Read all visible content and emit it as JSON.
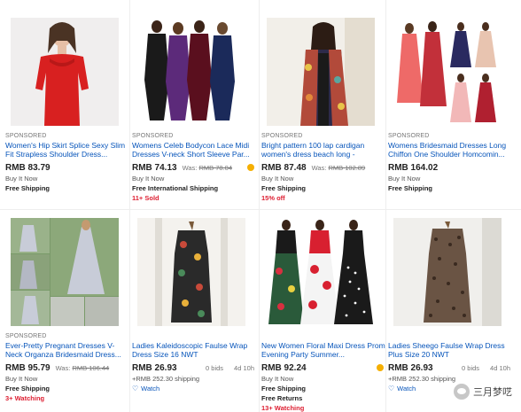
{
  "watermark_text": "三月梦呓",
  "colors": {
    "link": "#0654ba",
    "red": "#dd1e31",
    "badge": "#f5af02"
  },
  "row1": [
    {
      "sponsored": "SPONSORED",
      "title": "Women's Hip Skirt Splice Sexy Slim Fit Strapless Shoulder Dress...",
      "price": "RMB 83.79",
      "was": "",
      "line1": "Buy It Now",
      "line2": "Free Shipping",
      "line3": ""
    },
    {
      "sponsored": "SPONSORED",
      "title": "Womens Celeb Bodycon Lace Midi Dresses V-neck Short Sleeve Par...",
      "price": "RMB 74.13",
      "was_label": "Was:",
      "was": "RMB 78.04",
      "line1": "Buy It Now",
      "line2": "Free International Shipping",
      "line3": "11+ Sold"
    },
    {
      "sponsored": "SPONSORED",
      "title": "Bright pattern 100 lap cardigan women's dress beach long -",
      "price": "RMB 87.48",
      "was_label": "Was:",
      "was": "RMB 102.89",
      "line1": "Buy It Now",
      "line2": "Free Shipping",
      "line3": "15% off"
    },
    {
      "sponsored": "SPONSORED",
      "title": "Womens Bridesmaid Dresses Long Chiffon One Shoulder Homcomin...",
      "price": "RMB 164.02",
      "was": "",
      "line1": "Buy It Now",
      "line2": "Free Shipping",
      "line3": ""
    }
  ],
  "row2": [
    {
      "sponsored": "SPONSORED",
      "title": "Ever-Pretty Pregnant Dresses V-Neck Organza Bridesmaid Dress...",
      "price": "RMB 95.79",
      "was_label": "Was:",
      "was": "RMB 106.44",
      "line1": "Buy It Now",
      "line2": "Free Shipping",
      "line3": "3+ Watching"
    },
    {
      "sponsored": "",
      "title": "Ladies Kaleidoscopic Faulse Wrap Dress Size 16 NWT",
      "price": "RMB 26.93",
      "bids": "0 bids",
      "time": "4d 10h",
      "line1": "+RMB 252.30 shipping",
      "watch": "Watch"
    },
    {
      "sponsored": "",
      "title": "New Women Floral Maxi Dress Prom Evening Party Summer...",
      "price": "RMB 92.24",
      "was": "",
      "line1": "Buy It Now",
      "line2": "Free Shipping",
      "line3": "Free Returns",
      "line4": "13+ Watching"
    },
    {
      "sponsored": "",
      "title": "Ladies Sheego Faulse Wrap Dress Plus Size 20 NWT",
      "price": "RMB 26.93",
      "bids": "0 bids",
      "time": "4d 10h",
      "line1": "+RMB 252.30 shipping",
      "watch": "Watch"
    }
  ],
  "icons": {
    "heart": "heart-icon",
    "top_rated": "top-rated-badge-icon"
  }
}
